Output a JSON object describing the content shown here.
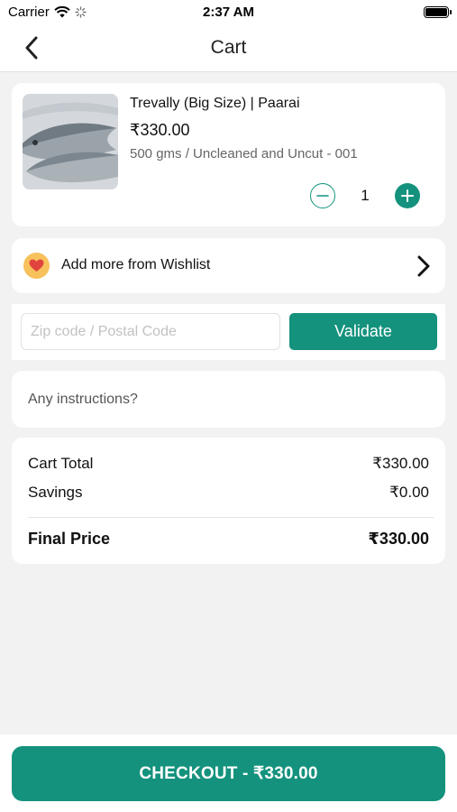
{
  "status_bar": {
    "carrier": "Carrier",
    "time": "2:37 AM"
  },
  "nav": {
    "title": "Cart"
  },
  "cart_item": {
    "name": "Trevally (Big Size) | Paarai",
    "price": "₹330.00",
    "variant": "500 gms / Uncleaned and Uncut - 001",
    "quantity": "1"
  },
  "wishlist": {
    "label": "Add more from Wishlist"
  },
  "zip": {
    "placeholder": "Zip code / Postal Code",
    "value": "",
    "validate_label": "Validate"
  },
  "instructions": {
    "placeholder": "Any instructions?",
    "value": ""
  },
  "totals": {
    "cart_total_label": "Cart Total",
    "cart_total_value": "₹330.00",
    "savings_label": "Savings",
    "savings_value": "₹0.00",
    "final_label": "Final Price",
    "final_value": "₹330.00"
  },
  "checkout": {
    "label": "CHECKOUT - ₹330.00"
  },
  "colors": {
    "accent": "#14927d",
    "background": "#f2f2f3",
    "wishlist_badge": "#f7c15c",
    "heart": "#e0443c"
  },
  "icons": {
    "back": "chevron-left-icon",
    "wifi": "wifi-icon",
    "activity": "activity-spinner-icon",
    "battery": "battery-icon",
    "minus": "minus-circle-icon",
    "plus": "plus-circle-icon",
    "wishlist": "heart-icon",
    "wishlist_arrow": "chevron-right-icon"
  }
}
